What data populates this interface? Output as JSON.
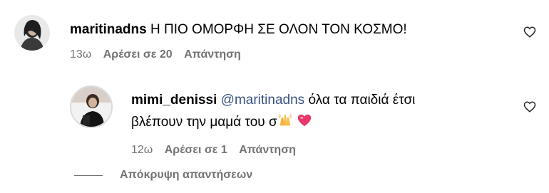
{
  "comment": {
    "username": "maritinadns",
    "text": "Η ΠΙΟ ΟΜΟΡΦΗ ΣΕ ΟΛΟΝ ΤΟΝ ΚΟΣΜΟ!",
    "time": "13ω",
    "likes": "Αρέσει σε 20",
    "reply": "Απάντηση",
    "avatar_icon": "profile-photo-icon",
    "like_icon": "heart-outline-icon"
  },
  "reply": {
    "username": "mimi_denissi",
    "mention": "@maritinadns",
    "text_line1": "όλα τα παιδιά έτσι",
    "text_line2": "βλέπουν την μαμά του σ",
    "emojis": [
      "raising-hands-emoji",
      "pink-heart-emoji"
    ],
    "time": "12ω",
    "likes": "Αρέσει σε 1",
    "reply": "Απάντηση",
    "avatar_icon": "profile-photo-icon",
    "like_icon": "heart-outline-icon"
  },
  "hide_replies": "Απόκρυψη απαντήσεων",
  "colors": {
    "mention": "#385185",
    "meta": "#737373",
    "emoji_heart": "#e8386b",
    "emoji_hands": "#f5b43c"
  }
}
